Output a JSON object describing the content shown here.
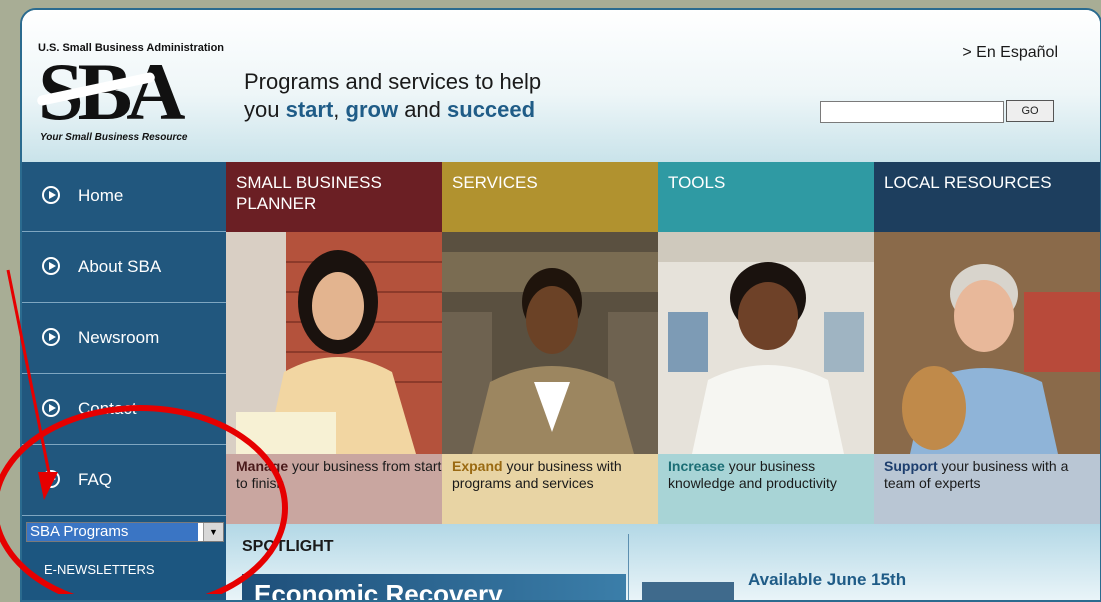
{
  "header": {
    "logo_top": "U.S. Small Business Administration",
    "logo_mark": "SBA",
    "logo_tagline": "Your Small Business Resource",
    "tagline_line1": "Programs and services to help",
    "tagline_you": "you ",
    "tagline_start": "start",
    "tagline_comma": ", ",
    "tagline_grow": "grow",
    "tagline_and": " and ",
    "tagline_succeed": "succeed",
    "espanol_link": "> En Español",
    "search_value": "",
    "go_label": "GO"
  },
  "sidebar": {
    "items": [
      {
        "label": "Home"
      },
      {
        "label": "About SBA"
      },
      {
        "label": "Newsroom"
      },
      {
        "label": "Contact"
      },
      {
        "label": "FAQ"
      }
    ],
    "programs_select": "SBA Programs",
    "enewsletters": "E-NEWSLETTERS"
  },
  "columns": [
    {
      "title": "SMALL BUSINESS PLANNER",
      "keyword": "Manage",
      "rest": " your business from start to finish"
    },
    {
      "title": "SERVICES",
      "keyword": "Expand",
      "rest": " your business with programs and services"
    },
    {
      "title": "TOOLS",
      "keyword": "Increase",
      "rest": " your business knowledge and productivity"
    },
    {
      "title": "LOCAL RESOURCES",
      "keyword": "Support",
      "rest": " your business with a team of experts"
    }
  ],
  "spotlight": {
    "title": "SPOTLIGHT",
    "banner": "Economic Recovery",
    "available": "Available June 15th"
  },
  "colors": {
    "nav_blue": "#21577e",
    "planner": "#6b1f24",
    "services": "#b1922f",
    "tools": "#2f9aa3",
    "local": "#1d3e5e",
    "annotation_red": "#e60000"
  }
}
